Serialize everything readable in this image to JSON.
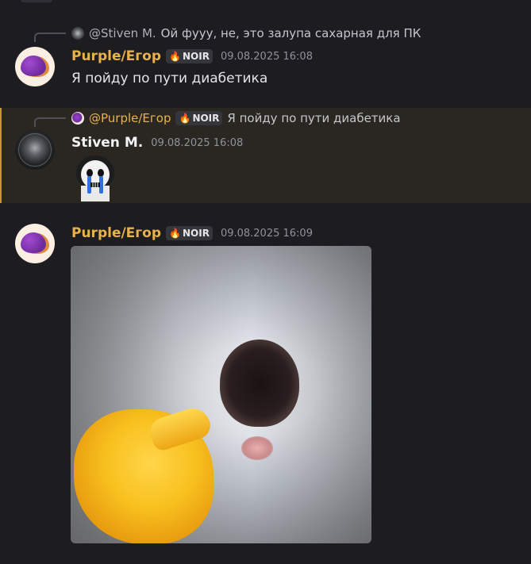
{
  "colors": {
    "background": "#1c1c21",
    "username_gold": "#e8b24a",
    "highlight_bg": "#2a2722",
    "highlight_border": "#c49a2c",
    "timestamp": "#8f939a"
  },
  "messages": [
    {
      "reply": {
        "avatar_icon": "skull-avatar-icon",
        "mention": "@Stiven M.",
        "text": "Ой фууу, не, это залупа сахарная для ПК"
      },
      "author": "Purple/Егор",
      "tag": {
        "icon": "fire-icon",
        "label": "NOIR"
      },
      "timestamp": "09.08.2025 16:08",
      "content": "Я пойду по пути диабетика"
    },
    {
      "reply": {
        "avatar_icon": "purple-blob-avatar-icon",
        "mention": "@Purple/Егор",
        "tag": {
          "icon": "fire-icon",
          "label": "NOIR"
        },
        "text": "Я пойду по пути диабетика"
      },
      "author": "Stiven M.",
      "timestamp": "09.08.2025 16:08",
      "attachment": "crying-skeleton-sticker"
    },
    {
      "author": "Purple/Егор",
      "tag": {
        "icon": "fire-icon",
        "label": "NOIR"
      },
      "timestamp": "09.08.2025 16:09",
      "attachment": "screaming-cat-pointing-gif"
    }
  ]
}
